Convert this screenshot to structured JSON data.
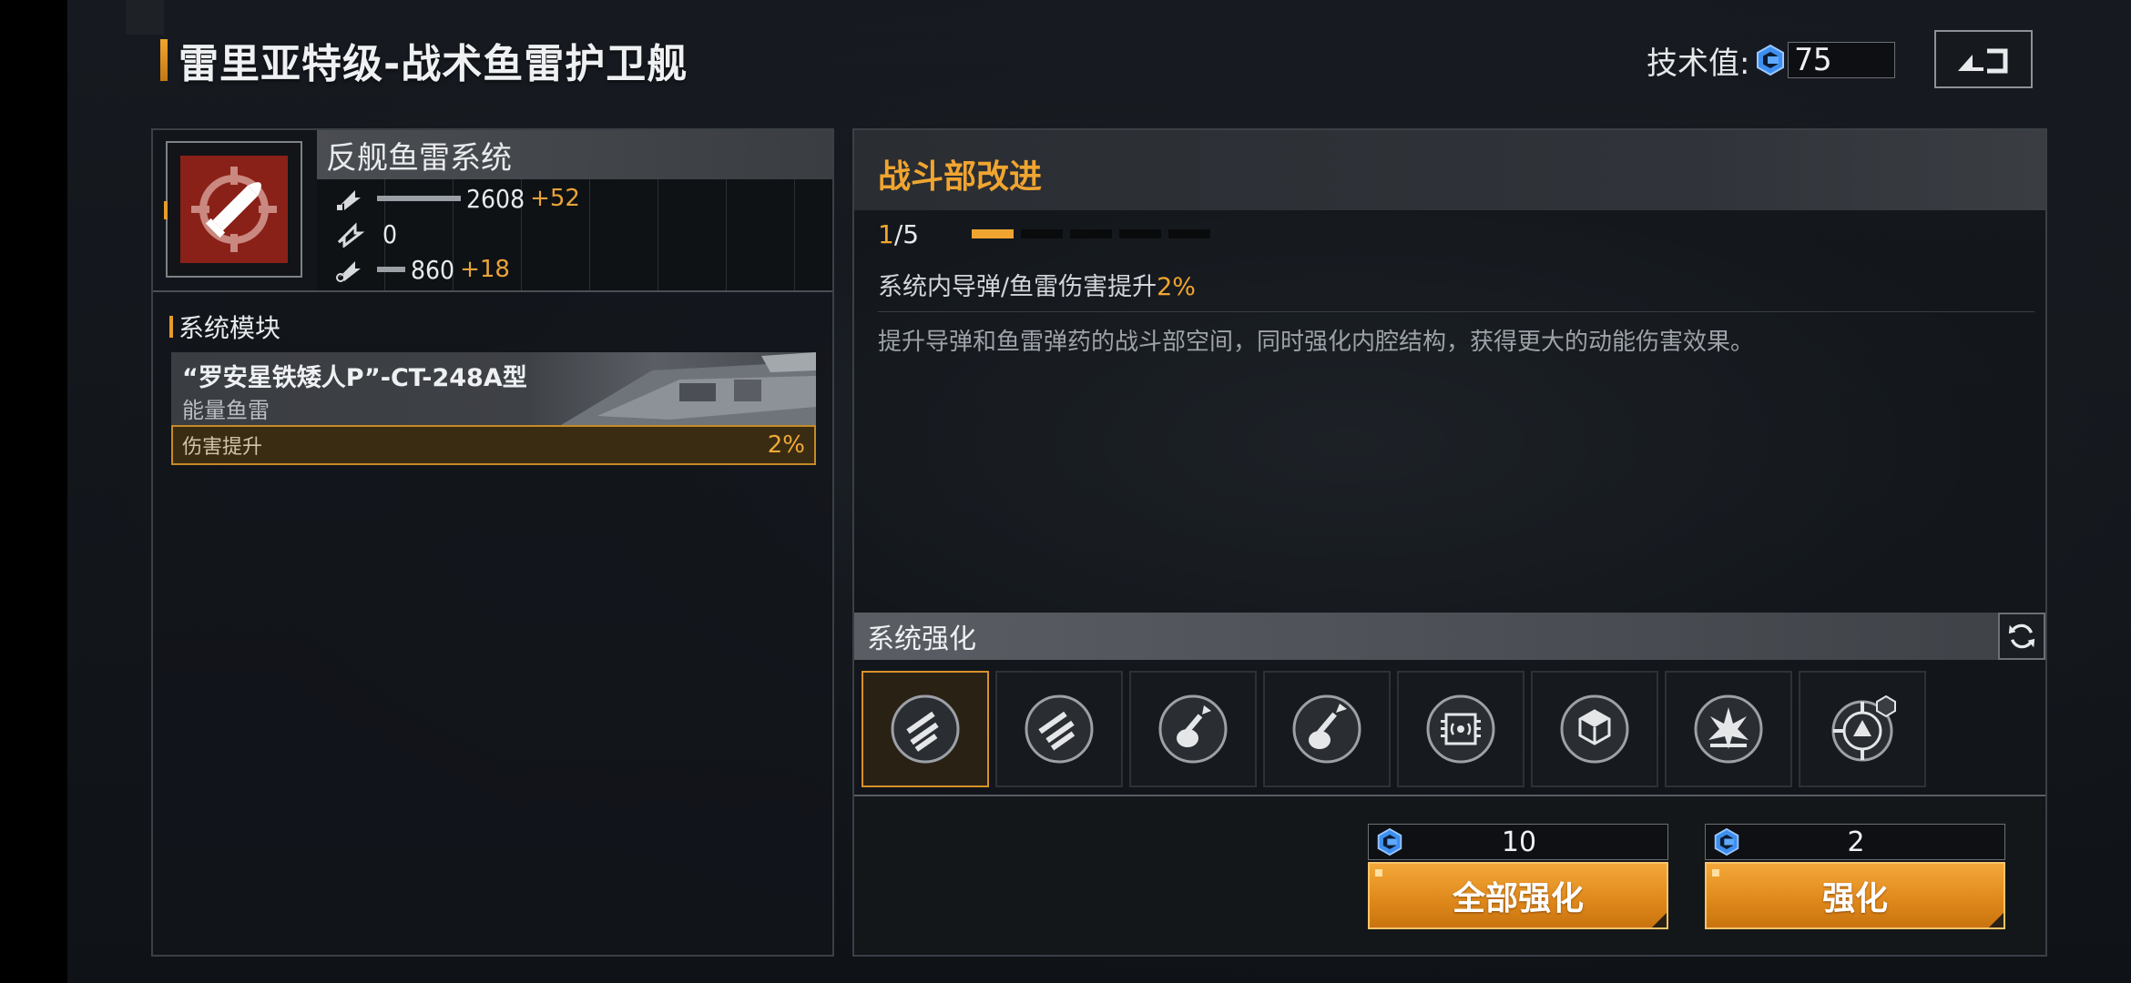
{
  "header": {
    "title": "雷里亚特级-战术鱼雷护卫舰",
    "tech_label": "技术值:",
    "tech_value": "75"
  },
  "weapon": {
    "name": "反舰鱼雷系统",
    "stats": [
      {
        "icon": "attack-stat-icon",
        "value": "2608",
        "bonus": "+52",
        "bar_fraction": 0.33
      },
      {
        "icon": "secondary-stat-icon",
        "value": "0",
        "bonus": "",
        "bar_fraction": 0
      },
      {
        "icon": "siege-stat-icon",
        "value": "860",
        "bonus": "+18",
        "bar_fraction": 0.11
      }
    ]
  },
  "modules": {
    "title": "系统模块",
    "card": {
      "name": "“罗安星铁矮人P”-CT-248A型",
      "type": "能量鱼雷",
      "bonus_label": "伤害提升",
      "bonus_value": "2%"
    }
  },
  "upgrade": {
    "title": "战斗部改进",
    "level_current": "1",
    "level_max": "/5",
    "level_fraction": 0.2,
    "effect_prefix": "系统内导弹/鱼雷伤害提升",
    "effect_value": "2%",
    "description": "提升导弹和鱼雷弹药的战斗部空间，同时强化内腔结构，获得更大的动能伤害效果。"
  },
  "enhance": {
    "title": "系统强化",
    "slots": [
      "missile-rack-icon",
      "missile-rack-alt-icon",
      "guitar-missile-icon",
      "guitar-missile-alt-icon",
      "chip-signal-icon",
      "cube-shield-icon",
      "explosion-icon",
      "target-radar-icon"
    ],
    "selected_slot": 0
  },
  "actions": {
    "enhance_all": {
      "cost": "10",
      "label": "全部强化"
    },
    "enhance_one": {
      "cost": "2",
      "label": "强化"
    }
  },
  "colors": {
    "accent": "#f0a530",
    "weapon_icon_bg": "#8a2118",
    "gem": "#3d8ff0"
  }
}
